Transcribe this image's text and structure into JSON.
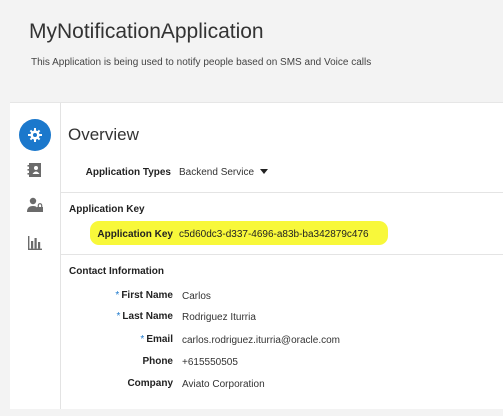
{
  "header": {
    "title": "MyNotificationApplication",
    "description": "This Application is being used to notify people based on SMS and Voice calls"
  },
  "nav": {
    "items": [
      {
        "icon": "gear-icon",
        "active": true
      },
      {
        "icon": "contact-book-icon",
        "active": false
      },
      {
        "icon": "user-lock-icon",
        "active": false
      },
      {
        "icon": "bar-chart-icon",
        "active": false
      }
    ]
  },
  "overview": {
    "title": "Overview",
    "app_types_label": "Application Types",
    "app_types_value": "Backend Service"
  },
  "app_key": {
    "heading": "Application Key",
    "label": "Application Key",
    "value": "c5d60dc3-d337-4696-a83b-ba342879c476"
  },
  "contact": {
    "heading": "Contact Information",
    "first_name_label": "First Name",
    "first_name": "Carlos",
    "last_name_label": "Last Name",
    "last_name": "Rodriguez Iturria",
    "email_label": "Email",
    "email": "carlos.rodriguez.iturria@oracle.com",
    "phone_label": "Phone",
    "phone": "+615550505",
    "company_label": "Company",
    "company": "Aviato Corporation"
  },
  "colors": {
    "accent": "#1b78cc",
    "highlight": "#f8f83a",
    "background": "#f3f3f3"
  }
}
